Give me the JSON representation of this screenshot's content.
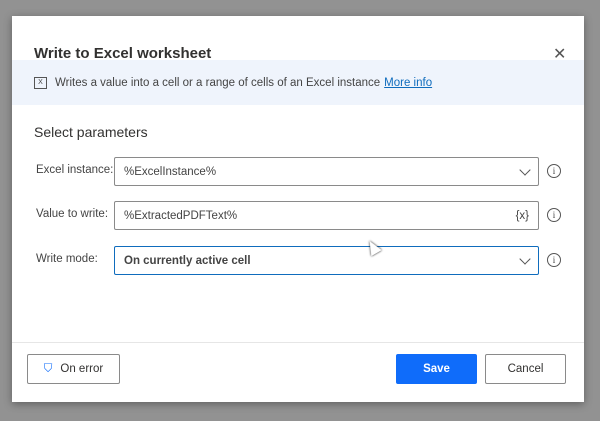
{
  "dialog": {
    "title": "Write to Excel worksheet",
    "close_icon": "close-icon"
  },
  "info": {
    "text": "Writes a value into a cell or a range of cells of an Excel instance",
    "link": "More info",
    "icon": "excel-icon"
  },
  "section_title": "Select parameters",
  "fields": [
    {
      "label": "Excel instance:",
      "value": "%ExcelInstance%"
    },
    {
      "label": "Value to write:",
      "value": "%ExtractedPDFText%",
      "suffix": "{x}"
    },
    {
      "label": "Write mode:",
      "value": "On currently active cell"
    }
  ],
  "footer": {
    "on_error": "On error",
    "save": "Save",
    "cancel": "Cancel"
  },
  "colors": {
    "accent": "#0f6cfa"
  }
}
